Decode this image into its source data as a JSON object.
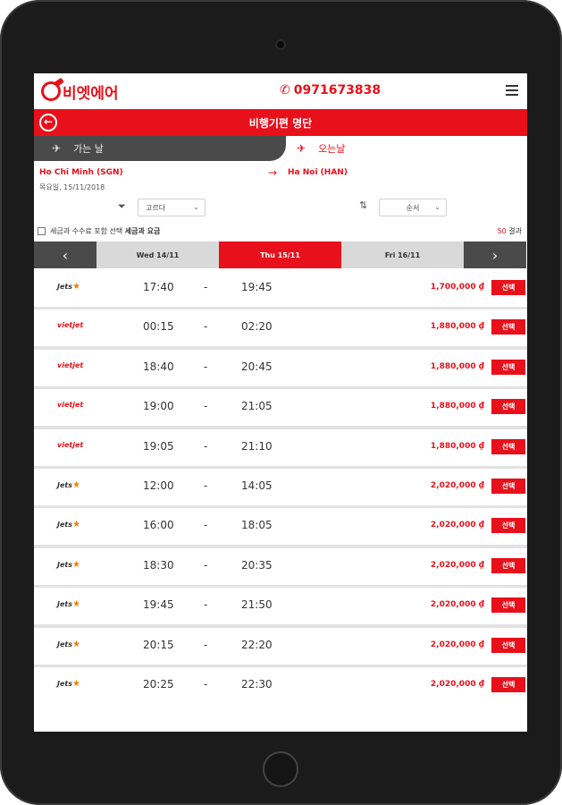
{
  "header": {
    "brand": "비엣에어",
    "phone": "0971673838"
  },
  "title_bar": {
    "title": "비행기편 명단"
  },
  "tabs": {
    "departure": "가는 날",
    "return": "오는날"
  },
  "route": {
    "from": "Ho Chi Minh (SGN)",
    "to": "Ha Noi (HAN)",
    "date": "목요일, 15/11/2018"
  },
  "filters": {
    "filter_value": "고르다",
    "sort_value": "순서"
  },
  "tax_option": {
    "label_pre": "세금과 수수료 포함 선택 ",
    "label_bold": "세금과 요금"
  },
  "results": {
    "count": "50",
    "suffix": " 결과"
  },
  "date_bar": {
    "prev": "‹",
    "next": "›",
    "days": [
      "Wed 14/11",
      "Thu 15/11",
      "Fri 16/11"
    ]
  },
  "select_label": "선택",
  "colors": {
    "brand_red": "#e8101a",
    "dark_gray": "#4a4a4a",
    "jetstar_orange": "#f07f00"
  },
  "flights": [
    {
      "airline": "Jetstar",
      "dep": "17:40",
      "arr": "19:45",
      "price": "1,700,000 ₫"
    },
    {
      "airline": "Vietjet",
      "dep": "00:15",
      "arr": "02:20",
      "price": "1,880,000 ₫"
    },
    {
      "airline": "Vietjet",
      "dep": "18:40",
      "arr": "20:45",
      "price": "1,880,000 ₫"
    },
    {
      "airline": "Vietjet",
      "dep": "19:00",
      "arr": "21:05",
      "price": "1,880,000 ₫"
    },
    {
      "airline": "Vietjet",
      "dep": "19:05",
      "arr": "21:10",
      "price": "1,880,000 ₫"
    },
    {
      "airline": "Jetstar",
      "dep": "12:00",
      "arr": "14:05",
      "price": "2,020,000 ₫"
    },
    {
      "airline": "Jetstar",
      "dep": "16:00",
      "arr": "18:05",
      "price": "2,020,000 ₫"
    },
    {
      "airline": "Jetstar",
      "dep": "18:30",
      "arr": "20:35",
      "price": "2,020,000 ₫"
    },
    {
      "airline": "Jetstar",
      "dep": "19:45",
      "arr": "21:50",
      "price": "2,020,000 ₫"
    },
    {
      "airline": "Jetstar",
      "dep": "20:15",
      "arr": "22:20",
      "price": "2,020,000 ₫"
    },
    {
      "airline": "Jetstar",
      "dep": "20:25",
      "arr": "22:30",
      "price": "2,020,000 ₫"
    }
  ]
}
